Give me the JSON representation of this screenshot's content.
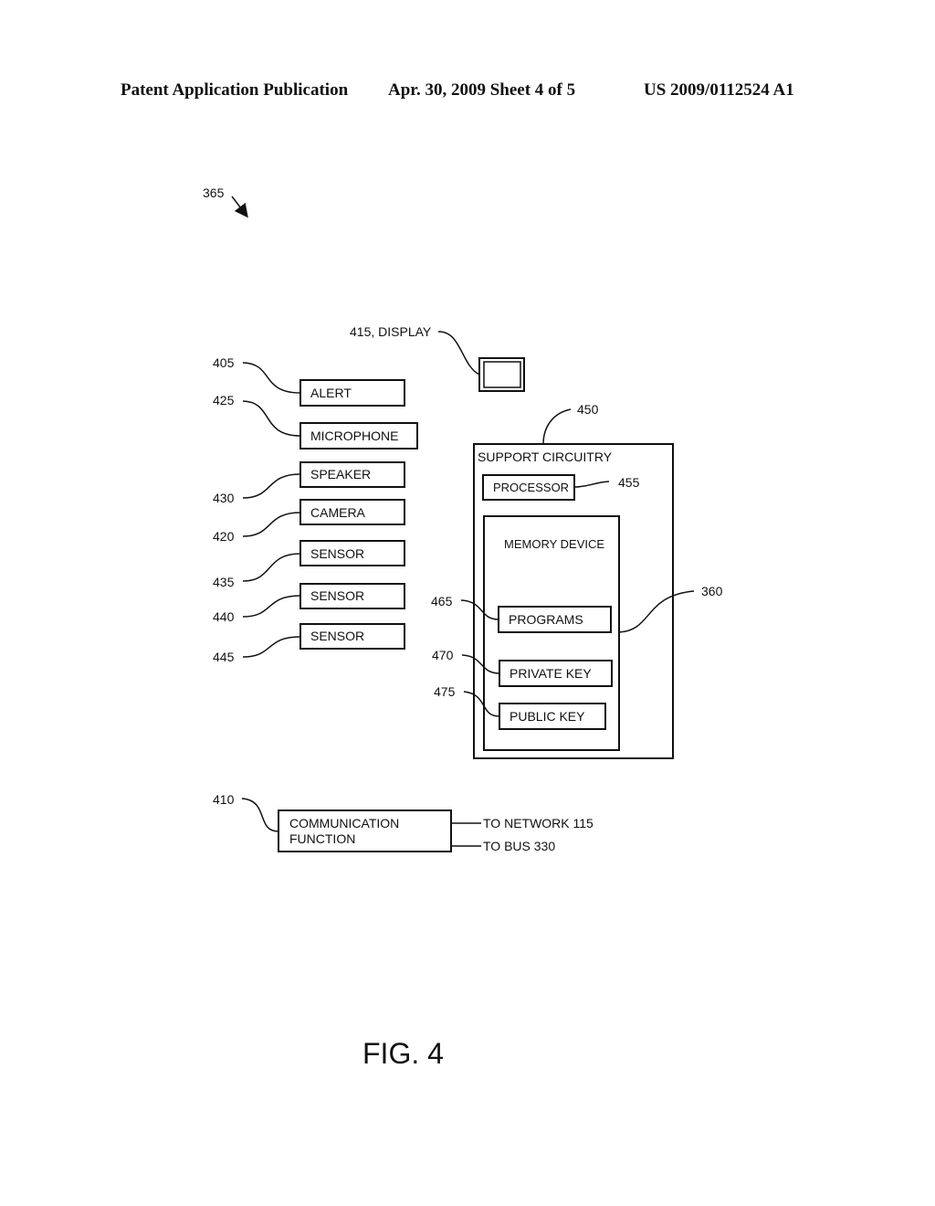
{
  "header": {
    "publication": "Patent Application Publication",
    "date_sheet": "Apr. 30, 2009  Sheet 4 of 5",
    "pub_number": "US 2009/0112524 A1"
  },
  "figure": {
    "ref_main": "365",
    "caption": "FIG. 4",
    "display": {
      "ref": "415, DISPLAY"
    },
    "components": [
      {
        "ref": "405",
        "label": "ALERT"
      },
      {
        "ref": "425",
        "label": "MICROPHONE"
      },
      {
        "ref": "430",
        "label": "SPEAKER"
      },
      {
        "ref": "420",
        "label": "CAMERA"
      },
      {
        "ref": "435",
        "label": "SENSOR"
      },
      {
        "ref": "440",
        "label": "SENSOR"
      },
      {
        "ref": "445",
        "label": "SENSOR"
      }
    ],
    "support": {
      "ref": "450",
      "label": "SUPPORT CIRCUITRY",
      "processor": {
        "ref": "455",
        "label": "PROCESSOR"
      },
      "memory": {
        "ref": "360",
        "label": "MEMORY DEVICE",
        "items": [
          {
            "ref": "465",
            "label": "PROGRAMS"
          },
          {
            "ref": "470",
            "label": "PRIVATE KEY"
          },
          {
            "ref": "475",
            "label": "PUBLIC KEY"
          }
        ]
      }
    },
    "communication": {
      "ref": "410",
      "label_line1": "COMMUNICATION",
      "label_line2": "FUNCTION",
      "outputs": [
        "TO NETWORK 115",
        "TO BUS 330"
      ]
    }
  }
}
